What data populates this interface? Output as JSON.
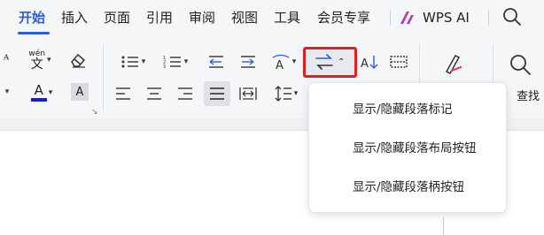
{
  "menu": {
    "tabs": [
      {
        "label": "开始",
        "active": true
      },
      {
        "label": "插入"
      },
      {
        "label": "页面"
      },
      {
        "label": "引用"
      },
      {
        "label": "审阅"
      },
      {
        "label": "视图"
      },
      {
        "label": "工具"
      },
      {
        "label": "会员专享"
      }
    ],
    "wps_ai_label": "WPS AI",
    "accent": "#2b5ddb"
  },
  "ribbon": {
    "phonetic_label": "wén",
    "phonetic_char": "文",
    "find_label": "查找",
    "highlight_color": "#e02020",
    "font_color_bar": "#1a1ad6"
  },
  "dropdown": {
    "items": [
      "显示/隐藏段落标记",
      "显示/隐藏段落布局按钮",
      "显示/隐藏段落柄按钮"
    ]
  }
}
